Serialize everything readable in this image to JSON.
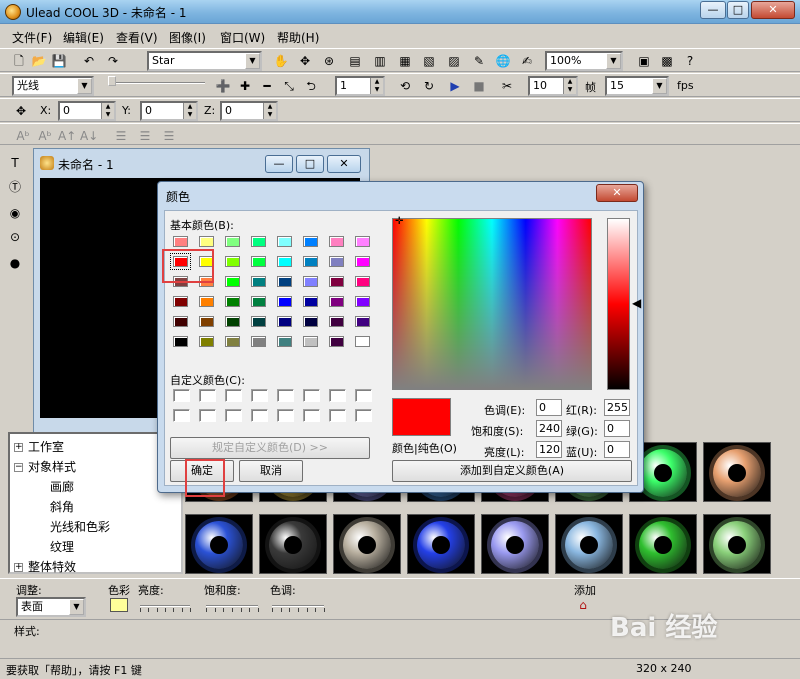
{
  "app": {
    "title": "Ulead COOL 3D - 未命名 - 1",
    "window_controls": [
      "—",
      "□",
      "✕"
    ]
  },
  "menu": [
    "文件(F)",
    "编辑(E)",
    "查看(V)",
    "图像(I)",
    "窗口(W)",
    "帮助(H)"
  ],
  "toolbar1": {
    "font_combo": "Star",
    "zoom_combo": "100%"
  },
  "toolbar2": {
    "mode_combo": "光线",
    "frame_value": "1",
    "frame_count": "10",
    "frame_label": "帧",
    "fps_value": "15",
    "fps_label": "fps"
  },
  "toolbar3": {
    "x_label": "X:",
    "x_value": "0",
    "y_label": "Y:",
    "y_value": "0",
    "z_label": "Z:",
    "z_value": "0"
  },
  "doc": {
    "title": "未命名 - 1"
  },
  "tree": {
    "items": [
      "工作室",
      "对象样式",
      "画廊",
      "斜角",
      "光线和色彩",
      "纹理",
      "整体特效"
    ]
  },
  "bottom": {
    "adjust_label": "调整:",
    "adjust_value": "表面",
    "color_label": "色彩",
    "brightness_label": "亮度:",
    "saturation_label": "饱和度:",
    "hue_label": "色调:",
    "add_label": "添加",
    "style_label": "样式:"
  },
  "status": {
    "help_text": "要获取「帮助」，请按 F1 键",
    "size_text": "320 x 240"
  },
  "dialog": {
    "title": "颜色",
    "basic_colors_label": "基本颜色(B):",
    "custom_colors_label": "自定义颜色(C):",
    "define_custom_button": "规定自定义颜色(D) >>",
    "ok_button": "确定",
    "cancel_button": "取消",
    "add_custom_button": "添加到自定义颜色(A)",
    "color_solid_label": "颜色|纯色(O)",
    "hue_label": "色调(E):",
    "hue_value": "0",
    "sat_label": "饱和度(S):",
    "sat_value": "240",
    "lum_label": "亮度(L):",
    "lum_value": "120",
    "red_label": "红(R):",
    "red_value": "255",
    "green_label": "绿(G):",
    "green_value": "0",
    "blue_label": "蓝(U):",
    "blue_value": "0",
    "basic_colors": [
      [
        "#ff8080",
        "#ffff80",
        "#80ff80",
        "#00ff80",
        "#80ffff",
        "#0080ff",
        "#ff80c0",
        "#ff80ff"
      ],
      [
        "#ff0000",
        "#ffff00",
        "#80ff00",
        "#00ff40",
        "#00ffff",
        "#0080c0",
        "#8080c0",
        "#ff00ff"
      ],
      [
        "#804040",
        "#ff8040",
        "#00ff00",
        "#008080",
        "#004080",
        "#8080ff",
        "#800040",
        "#ff0080"
      ],
      [
        "#800000",
        "#ff8000",
        "#008000",
        "#008040",
        "#0000ff",
        "#0000a0",
        "#800080",
        "#8000ff"
      ],
      [
        "#400000",
        "#804000",
        "#004000",
        "#004040",
        "#000080",
        "#000040",
        "#400040",
        "#400080"
      ],
      [
        "#000000",
        "#808000",
        "#808040",
        "#808080",
        "#408080",
        "#c0c0c0",
        "#400040",
        "#ffffff"
      ]
    ],
    "custom_colors_count": 16
  },
  "thumbs": {
    "colors": [
      "#ff8a3c",
      "#ffd84a",
      "#9a9aff",
      "#4aa0ff",
      "#ff55aa",
      "#7fe07f",
      "#3cff6a",
      "#e7a070",
      "#2b52d6",
      "#3a3a3a",
      "#b9b0a0",
      "#2440e8",
      "#9a9af0",
      "#8ab7e0",
      "#2fbf2f",
      "#8ad07a"
    ]
  },
  "watermark": "Bai 经验"
}
